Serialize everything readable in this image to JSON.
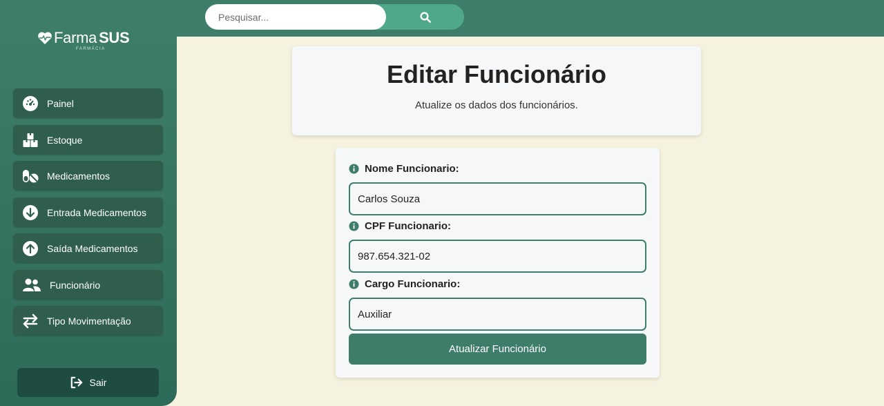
{
  "brand": {
    "name_light": "Farma",
    "name_bold": "SUS",
    "tagline": "FARMÁCIA"
  },
  "search": {
    "placeholder": "Pesquisar...",
    "icon": "search-icon"
  },
  "sidebar": {
    "items": [
      {
        "label": "Painel",
        "icon": "dashboard-gauge-icon"
      },
      {
        "label": "Estoque",
        "icon": "boxes-icon"
      },
      {
        "label": "Medicamentos",
        "icon": "pills-icon"
      },
      {
        "label": "Entrada Medicamentos",
        "icon": "arrow-down-circle-icon"
      },
      {
        "label": "Saída Medicamentos",
        "icon": "arrow-up-circle-icon"
      },
      {
        "label": "Funcionário",
        "icon": "users-icon"
      },
      {
        "label": "Tipo Movimentação",
        "icon": "exchange-arrows-icon"
      }
    ],
    "logout_label": "Sair"
  },
  "header": {
    "title": "Editar Funcionário",
    "subtitle": "Atualize os dados dos funcionários."
  },
  "form": {
    "fields": [
      {
        "label": "Nome Funcionario:",
        "value": "Carlos Souza"
      },
      {
        "label": "CPF Funcionario:",
        "value": "987.654.321-02"
      },
      {
        "label": "Cargo Funcionario:",
        "value": "Auxiliar"
      }
    ],
    "submit_label": "Atualizar Funcionário"
  },
  "colors": {
    "primary": "#3d7d69",
    "sidebar_item": "#2f5e4d",
    "background": "#f5f3df",
    "search_button": "#4fa889"
  }
}
